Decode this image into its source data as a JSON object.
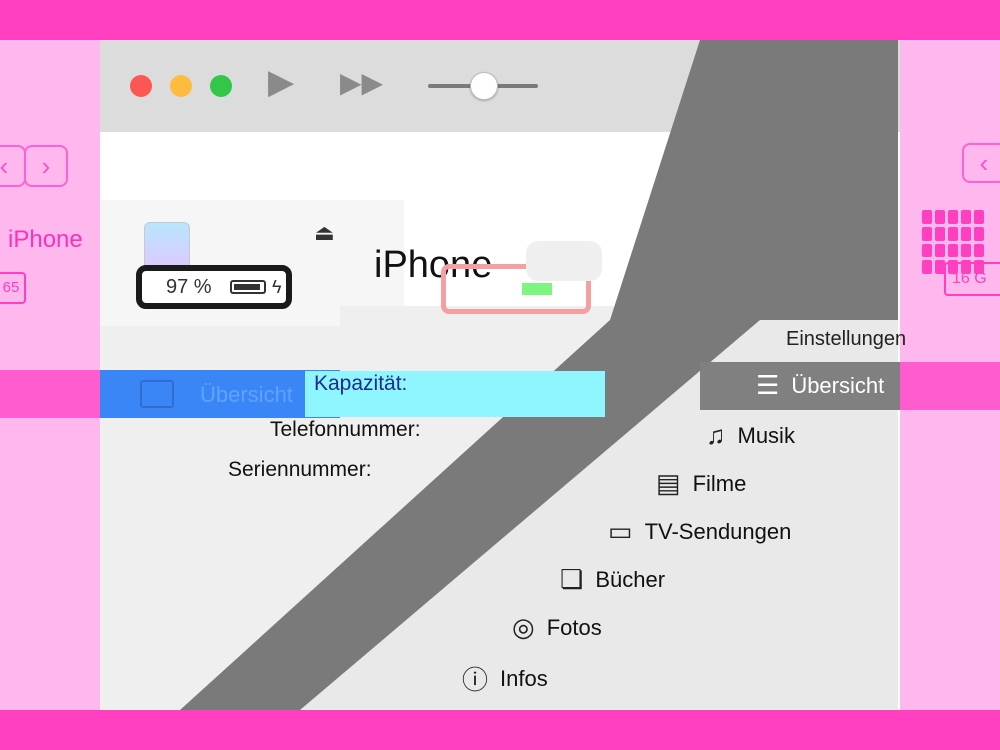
{
  "left_ghost": {
    "back": "‹",
    "forward": "›",
    "device": "iPhone",
    "capacity_badge": "65"
  },
  "right_ghost": {
    "nav": "‹",
    "capacity_badge": "16 G"
  },
  "titlebar": {
    "play_icon": "▶",
    "ff_icon": "▶▶"
  },
  "device": {
    "name": "iPhone",
    "battery_pct": "97 %",
    "eject_icon": "⏏"
  },
  "sidebar": {
    "selected_item": "Übersicht"
  },
  "content": {
    "title": "iPhone",
    "capacity_label": "Kapazität:",
    "phone_label": "Telefonnummer:",
    "serial_label": "Seriennummer:"
  },
  "settings": {
    "heading": "Einstellungen",
    "items": [
      {
        "label": "Übersicht",
        "icon": "summary-icon",
        "glyph": "☰"
      },
      {
        "label": "Musik",
        "icon": "music-icon",
        "glyph": "♫"
      },
      {
        "label": "Filme",
        "icon": "film-icon",
        "glyph": "▤"
      },
      {
        "label": "TV-Sendungen",
        "icon": "tv-icon",
        "glyph": "▭"
      },
      {
        "label": "Bücher",
        "icon": "book-icon",
        "glyph": "❏"
      },
      {
        "label": "Fotos",
        "icon": "camera-icon",
        "glyph": "◎"
      },
      {
        "label": "Infos",
        "icon": "info-icon",
        "glyph": "ⓘ"
      }
    ]
  },
  "colors": {
    "frame": "#ff3fbf",
    "selection": "#3b86f7",
    "highlight": "#8ff5ff",
    "battery_fill": "#7ef57e"
  }
}
